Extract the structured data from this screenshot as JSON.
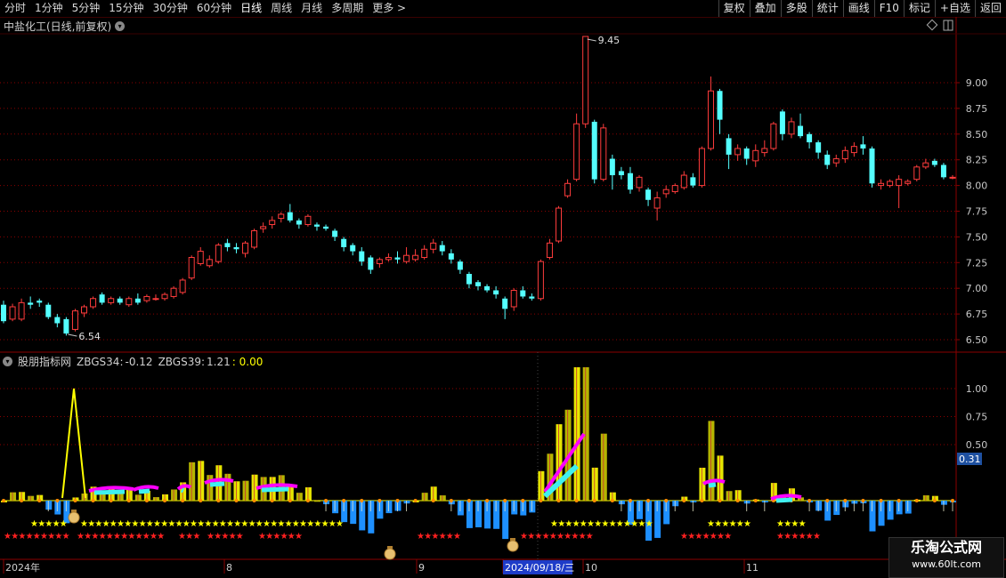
{
  "toolbar": {
    "timeframes": [
      "分时",
      "1分钟",
      "5分钟",
      "15分钟",
      "30分钟",
      "60分钟",
      "日线",
      "周线",
      "月线",
      "多周期",
      "更多 >"
    ],
    "active_timeframe": "日线",
    "right_buttons": [
      "复权",
      "叠加",
      "多股",
      "统计",
      "画线",
      "F10",
      "标记",
      "+自选",
      "返回"
    ]
  },
  "chart_title": "中盐化工(日线,前复权)",
  "price_axis": {
    "ticks": [
      "9.00",
      "8.75",
      "8.50",
      "8.25",
      "8.00",
      "7.75",
      "7.50",
      "7.25",
      "7.00",
      "6.75",
      "6.50"
    ]
  },
  "annotations": {
    "high_label": "9.45",
    "low_label": "6.54"
  },
  "indicator": {
    "name": "股朋指标网",
    "zbgs34_label": "ZBGS34:",
    "zbgs34_value": "-0.12",
    "zbgs39_label": "ZBGS39:",
    "zbgs39_value": "1.21",
    "extra_value": ": 0.00",
    "axis_ticks": [
      "1.00",
      "0.75",
      "0.50"
    ],
    "current_value": "0.31"
  },
  "date_axis": {
    "labels": [
      "2024年",
      "8",
      "9",
      "2024/09/18/三",
      "10",
      "11"
    ]
  },
  "watermark": {
    "line1": "乐淘公式网",
    "line2": "www.60lt.com"
  },
  "colors": {
    "up": "#ff3c3c",
    "down": "#54ffff",
    "grid": "#8b0000",
    "yellow": "#ffff00",
    "magenta": "#ff00ff",
    "blue": "#1e90ff"
  },
  "chart_data": {
    "type": "candlestick",
    "y_range": [
      6.4,
      9.5
    ],
    "candles": [
      [
        6.84,
        6.68,
        6.88,
        6.66
      ],
      [
        6.7,
        6.82,
        6.85,
        6.68
      ],
      [
        6.7,
        6.86,
        6.9,
        6.68
      ],
      [
        6.86,
        6.84,
        6.92,
        6.8
      ],
      [
        6.88,
        6.86,
        6.9,
        6.82
      ],
      [
        6.84,
        6.72,
        6.86,
        6.7
      ],
      [
        6.72,
        6.66,
        6.75,
        6.62
      ],
      [
        6.7,
        6.56,
        6.72,
        6.54
      ],
      [
        6.6,
        6.78,
        6.8,
        6.58
      ],
      [
        6.76,
        6.82,
        6.84,
        6.72
      ],
      [
        6.82,
        6.9,
        6.92,
        6.8
      ],
      [
        6.94,
        6.86,
        6.96,
        6.84
      ],
      [
        6.86,
        6.9,
        6.92,
        6.84
      ],
      [
        6.9,
        6.86,
        6.92,
        6.84
      ],
      [
        6.84,
        6.9,
        6.92,
        6.82
      ],
      [
        6.9,
        6.86,
        6.95,
        6.84
      ],
      [
        6.88,
        6.92,
        6.94,
        6.86
      ],
      [
        6.9,
        6.9,
        6.94,
        6.88
      ],
      [
        6.9,
        6.94,
        6.96,
        6.88
      ],
      [
        6.92,
        7.0,
        7.02,
        6.9
      ],
      [
        6.96,
        7.08,
        7.1,
        6.94
      ],
      [
        7.1,
        7.3,
        7.32,
        7.08
      ],
      [
        7.24,
        7.36,
        7.4,
        7.22
      ],
      [
        7.22,
        7.28,
        7.32,
        7.2
      ],
      [
        7.26,
        7.42,
        7.44,
        7.24
      ],
      [
        7.44,
        7.4,
        7.48,
        7.36
      ],
      [
        7.4,
        7.38,
        7.44,
        7.34
      ],
      [
        7.34,
        7.44,
        7.46,
        7.3
      ],
      [
        7.4,
        7.56,
        7.58,
        7.38
      ],
      [
        7.58,
        7.6,
        7.64,
        7.54
      ],
      [
        7.62,
        7.66,
        7.7,
        7.58
      ],
      [
        7.68,
        7.72,
        7.74,
        7.64
      ],
      [
        7.74,
        7.66,
        7.82,
        7.64
      ],
      [
        7.66,
        7.62,
        7.68,
        7.58
      ],
      [
        7.62,
        7.7,
        7.72,
        7.6
      ],
      [
        7.62,
        7.6,
        7.64,
        7.56
      ],
      [
        7.6,
        7.58,
        7.62,
        7.56
      ],
      [
        7.56,
        7.5,
        7.58,
        7.46
      ],
      [
        7.48,
        7.4,
        7.5,
        7.36
      ],
      [
        7.42,
        7.36,
        7.44,
        7.32
      ],
      [
        7.36,
        7.26,
        7.4,
        7.22
      ],
      [
        7.3,
        7.18,
        7.32,
        7.14
      ],
      [
        7.24,
        7.28,
        7.3,
        7.2
      ],
      [
        7.28,
        7.3,
        7.34,
        7.26
      ],
      [
        7.3,
        7.28,
        7.36,
        7.24
      ],
      [
        7.26,
        7.32,
        7.4,
        7.24
      ],
      [
        7.28,
        7.32,
        7.38,
        7.26
      ],
      [
        7.3,
        7.38,
        7.42,
        7.28
      ],
      [
        7.38,
        7.44,
        7.48,
        7.34
      ],
      [
        7.42,
        7.36,
        7.46,
        7.32
      ],
      [
        7.34,
        7.28,
        7.38,
        7.24
      ],
      [
        7.26,
        7.18,
        7.28,
        7.14
      ],
      [
        7.14,
        7.04,
        7.16,
        7.0
      ],
      [
        7.06,
        7.02,
        7.08,
        6.98
      ],
      [
        7.02,
        6.98,
        7.04,
        6.96
      ],
      [
        6.98,
        6.94,
        7.02,
        6.9
      ],
      [
        6.9,
        6.8,
        6.92,
        6.7
      ],
      [
        6.82,
        6.98,
        7.0,
        6.78
      ],
      [
        6.98,
        6.92,
        7.02,
        6.9
      ],
      [
        6.92,
        6.9,
        6.95,
        6.88
      ],
      [
        6.9,
        7.26,
        7.28,
        6.88
      ],
      [
        7.3,
        7.44,
        7.48,
        7.28
      ],
      [
        7.46,
        7.78,
        7.8,
        7.44
      ],
      [
        7.9,
        8.02,
        8.06,
        7.88
      ],
      [
        8.06,
        8.6,
        8.7,
        8.04
      ],
      [
        8.6,
        9.45,
        9.45,
        8.56
      ],
      [
        8.62,
        8.06,
        8.64,
        8.02
      ],
      [
        8.06,
        8.56,
        8.6,
        8.04
      ],
      [
        8.26,
        8.1,
        8.3,
        7.96
      ],
      [
        8.14,
        8.1,
        8.18,
        8.06
      ],
      [
        8.12,
        7.96,
        8.18,
        7.92
      ],
      [
        7.98,
        8.08,
        8.1,
        7.94
      ],
      [
        7.96,
        7.86,
        7.98,
        7.8
      ],
      [
        7.78,
        7.88,
        7.94,
        7.66
      ],
      [
        7.92,
        7.96,
        8.0,
        7.88
      ],
      [
        7.94,
        8.0,
        8.02,
        7.92
      ],
      [
        7.98,
        8.1,
        8.14,
        7.96
      ],
      [
        8.08,
        8.0,
        8.12,
        7.98
      ],
      [
        8.0,
        8.36,
        8.38,
        7.98
      ],
      [
        8.36,
        8.92,
        9.06,
        8.34
      ],
      [
        8.92,
        8.64,
        8.94,
        8.5
      ],
      [
        8.46,
        8.3,
        8.5,
        8.16
      ],
      [
        8.3,
        8.36,
        8.4,
        8.24
      ],
      [
        8.36,
        8.26,
        8.38,
        8.2
      ],
      [
        8.24,
        8.34,
        8.4,
        8.18
      ],
      [
        8.32,
        8.36,
        8.44,
        8.28
      ],
      [
        8.36,
        8.6,
        8.62,
        8.34
      ],
      [
        8.72,
        8.5,
        8.74,
        8.44
      ],
      [
        8.5,
        8.62,
        8.66,
        8.46
      ],
      [
        8.58,
        8.48,
        8.7,
        8.46
      ],
      [
        8.5,
        8.42,
        8.52,
        8.36
      ],
      [
        8.42,
        8.32,
        8.44,
        8.26
      ],
      [
        8.3,
        8.2,
        8.34,
        8.16
      ],
      [
        8.22,
        8.26,
        8.3,
        8.18
      ],
      [
        8.26,
        8.34,
        8.38,
        8.22
      ],
      [
        8.32,
        8.38,
        8.42,
        8.28
      ],
      [
        8.4,
        8.36,
        8.48,
        8.3
      ],
      [
        8.36,
        8.02,
        8.38,
        7.98
      ],
      [
        8.0,
        8.02,
        8.06,
        7.96
      ],
      [
        8.0,
        8.04,
        8.06,
        7.98
      ],
      [
        8.0,
        8.06,
        8.1,
        7.78
      ],
      [
        8.02,
        8.04,
        8.06,
        8.0
      ],
      [
        8.06,
        8.18,
        8.2,
        8.04
      ],
      [
        8.18,
        8.22,
        8.26,
        8.16
      ],
      [
        8.24,
        8.2,
        8.26,
        8.18
      ],
      [
        8.2,
        8.08,
        8.22,
        8.06
      ],
      [
        8.08,
        8.08,
        8.1,
        8.06
      ]
    ]
  }
}
